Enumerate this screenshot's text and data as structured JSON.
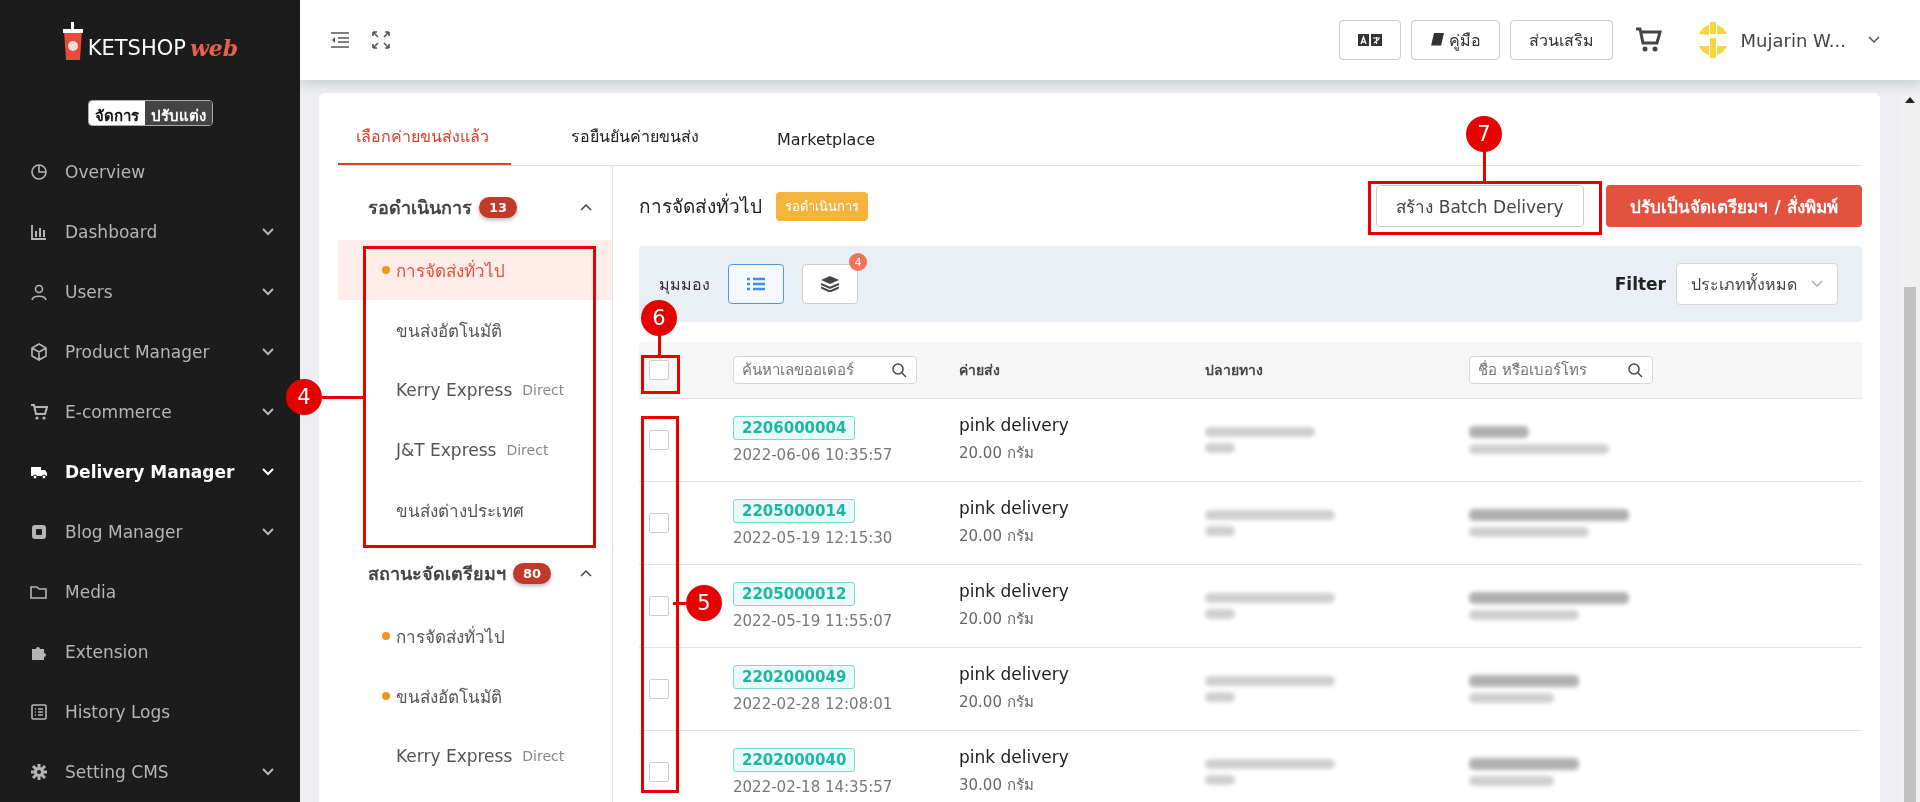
{
  "sidebar": {
    "logo": {
      "brand": "KETSHOP",
      "suffix": "web"
    },
    "modes": [
      {
        "label": "จัดการ",
        "selected": true
      },
      {
        "label": "ปรับแต่ง",
        "selected": false
      }
    ],
    "items": [
      {
        "label": "Overview",
        "selected": false,
        "expandable": false
      },
      {
        "label": "Dashboard",
        "selected": false,
        "expandable": true
      },
      {
        "label": "Users",
        "selected": false,
        "expandable": true
      },
      {
        "label": "Product Manager",
        "selected": false,
        "expandable": true
      },
      {
        "label": "E-commerce",
        "selected": false,
        "expandable": true
      },
      {
        "label": "Delivery Manager",
        "selected": true,
        "expandable": true
      },
      {
        "label": "Blog Manager",
        "selected": false,
        "expandable": true
      },
      {
        "label": "Media",
        "selected": false,
        "expandable": false
      },
      {
        "label": "Extension",
        "selected": false,
        "expandable": false
      },
      {
        "label": "History Logs",
        "selected": false,
        "expandable": false
      },
      {
        "label": "Setting CMS",
        "selected": false,
        "expandable": true
      }
    ]
  },
  "header": {
    "buttons": [
      {
        "kind": "translate"
      },
      {
        "kind": "manual",
        "label": "คู่มือ"
      },
      {
        "kind": "plain",
        "label": "ส่วนเสริม"
      }
    ],
    "user": "Mujarin W..."
  },
  "tabs": [
    {
      "label": "เลือกค่ายขนส่งแล้ว",
      "selected": true
    },
    {
      "label": "รอยืนยันค่ายขนส่ง",
      "selected": false
    },
    {
      "label": "Marketplace",
      "selected": false
    }
  ],
  "groups": [
    {
      "title": "รอดำเนินการ",
      "count": "13",
      "expanded": true,
      "items": [
        {
          "label": "การจัดส่งทั่วไป",
          "dot": true,
          "selected": true
        },
        {
          "label": "ขนส่งอัตโนมัติ",
          "dot": false,
          "selected": false
        },
        {
          "label": "Kerry Express",
          "tag": "Direct",
          "dot": false,
          "selected": false
        },
        {
          "label": "J&T Express",
          "tag": "Direct",
          "dot": false,
          "selected": false
        },
        {
          "label": "ขนส่งต่างประเทศ",
          "dot": false,
          "selected": false
        }
      ]
    },
    {
      "title": "สถานะจัดเตรียมฯ",
      "count": "80",
      "expanded": true,
      "items": [
        {
          "label": "การจัดส่งทั่วไป",
          "dot": true,
          "selected": false
        },
        {
          "label": "ขนส่งอัตโนมัติ",
          "dot": true,
          "selected": false
        },
        {
          "label": "Kerry Express",
          "tag": "Direct",
          "dot": false,
          "selected": false
        }
      ]
    }
  ],
  "content": {
    "title": "การจัดส่งทั่วไป",
    "status": "รอดำเนินการ",
    "actions": [
      {
        "kind": "outline",
        "label": "สร้าง Batch Delivery"
      },
      {
        "kind": "primary",
        "label": "ปรับเป็นจัดเตรียมฯ / สั่งพิมพ์"
      }
    ],
    "view_label": "มุมมอง",
    "views": [
      {
        "kind": "list",
        "selected": true
      },
      {
        "kind": "stack",
        "selected": false,
        "badge": "4"
      }
    ],
    "filter": {
      "label": "Filter",
      "value": "ประเภททั้งหมด"
    },
    "table": {
      "all_checked": false,
      "search_placeholder": "ค้นหาเลขออเดอร์",
      "columns": [
        "ค่ายส่ง",
        "ปลายทาง"
      ],
      "name_placeholder": "ชื่อ หรือเบอร์โทร",
      "rows": [
        {
          "checked": false,
          "order": "2206000004",
          "date": "2022-06-06 10:35:57",
          "carrier": "pink delivery",
          "weight": "20.00 กรัม"
        },
        {
          "checked": false,
          "order": "2205000014",
          "date": "2022-05-19 12:15:30",
          "carrier": "pink delivery",
          "weight": "20.00 กรัม"
        },
        {
          "checked": false,
          "order": "2205000012",
          "date": "2022-05-19 11:55:07",
          "carrier": "pink delivery",
          "weight": "20.00 กรัม"
        },
        {
          "checked": false,
          "order": "2202000049",
          "date": "2022-02-28 12:08:01",
          "carrier": "pink delivery",
          "weight": "20.00 กรัม"
        },
        {
          "checked": false,
          "order": "2202000040",
          "date": "2022-02-18 14:35:57",
          "carrier": "pink delivery",
          "weight": "30.00 กรัม"
        }
      ]
    }
  },
  "callouts": [
    {
      "number": "4",
      "kind": "left"
    },
    {
      "number": "5",
      "kind": "right"
    },
    {
      "number": "6",
      "kind": "top"
    },
    {
      "number": "7",
      "kind": "top"
    }
  ]
}
